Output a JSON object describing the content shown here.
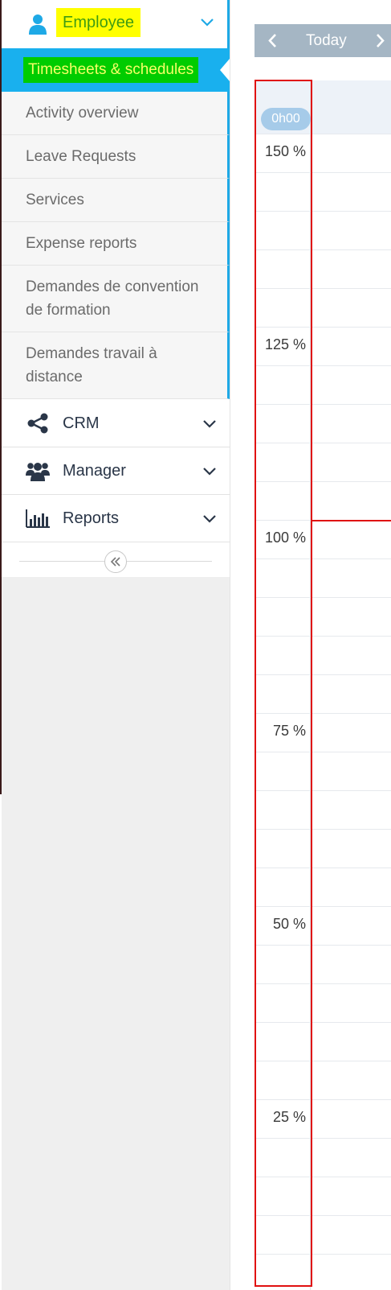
{
  "sidebar": {
    "employee": {
      "label": "Employee",
      "icon": "user-icon",
      "expanded": true
    },
    "active_item": {
      "label": "Timesheets & schedules"
    },
    "sub_items": [
      {
        "label": "Activity overview"
      },
      {
        "label": "Leave Requests"
      },
      {
        "label": "Services"
      },
      {
        "label": "Expense reports"
      },
      {
        "label": "Demandes de convention de formation"
      },
      {
        "label": "Demandes travail à distance"
      }
    ],
    "sections": [
      {
        "label": "CRM",
        "icon": "share-icon"
      },
      {
        "label": "Manager",
        "icon": "users-icon"
      },
      {
        "label": "Reports",
        "icon": "bar-chart-icon"
      }
    ],
    "collapse_icon": "double-chevron-left-icon"
  },
  "toolbar": {
    "today_label": "Today",
    "prev_icon": "chevron-left-icon",
    "next_icon": "chevron-right-icon"
  },
  "calendar": {
    "header_time": "0h00",
    "y_axis_labels": [
      "150 %",
      "125 %",
      "100 %",
      "75 %",
      "50 %",
      "25 %"
    ]
  },
  "colors": {
    "accent": "#1ea9e6",
    "highlight_yellow": "#ffff00",
    "highlight_green": "#00cc00",
    "toolbar_bg": "#a5b6c4",
    "annotation_red": "#e01010"
  }
}
